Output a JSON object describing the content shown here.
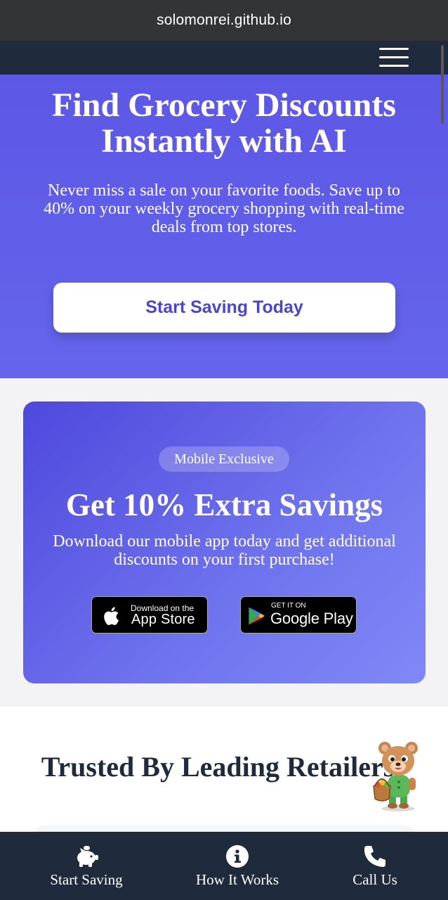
{
  "browser": {
    "url": "solomonrei.github.io"
  },
  "header": {
    "menu_icon": "hamburger-menu-icon"
  },
  "hero": {
    "title": "Find Grocery Discounts Instantly with AI",
    "subtitle": "Never miss a sale on your favorite foods. Save up to 40% on your weekly grocery shopping with real-time deals from top stores.",
    "cta_label": "Start Saving Today"
  },
  "promo": {
    "badge": "Mobile Exclusive",
    "title": "Get 10% Extra Savings",
    "description": "Download our mobile app today and get additional discounts on your first purchase!",
    "app_store": {
      "small": "Download on the",
      "big": "App Store",
      "icon": "apple-icon"
    },
    "google_play": {
      "small": "GET IT ON",
      "big": "Google Play",
      "icon": "google-play-icon"
    }
  },
  "trusted": {
    "title": "Trusted By Leading Retailers"
  },
  "bottom_nav": {
    "items": [
      {
        "label": "Start Saving",
        "icon": "piggy-bank-icon"
      },
      {
        "label": "How It Works",
        "icon": "info-icon"
      },
      {
        "label": "Call Us",
        "icon": "phone-icon"
      }
    ]
  },
  "colors": {
    "hero_bg": "#5d57e6",
    "promo_bg": "#6f74ee",
    "cta_text": "#4a45c9",
    "nav_bg": "#1f2a3d"
  }
}
